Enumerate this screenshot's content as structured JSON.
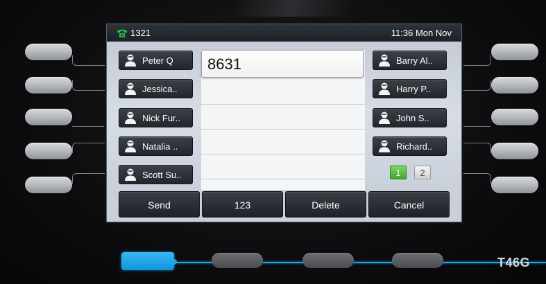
{
  "status_bar": {
    "line_number": "1321",
    "datetime": "11:36 Mon Nov",
    "phone_icon": "phone-handset-icon"
  },
  "contacts_left": [
    {
      "name": "Peter Q"
    },
    {
      "name": "Jessica.."
    },
    {
      "name": "Nick Fur.."
    },
    {
      "name": "Natalia .."
    },
    {
      "name": "Scott Su.."
    }
  ],
  "contacts_right": [
    {
      "name": "Barry Al.."
    },
    {
      "name": "Harry P.."
    },
    {
      "name": "John S.."
    },
    {
      "name": "Richard.."
    }
  ],
  "dial_entry": {
    "value": "8631"
  },
  "pages": {
    "page1": "1",
    "page2": "2",
    "current": 1
  },
  "softkeys": {
    "send": "Send",
    "mode": "123",
    "delete": "Delete",
    "cancel": "Cancel"
  },
  "device": {
    "model": "T46G"
  },
  "colors": {
    "accent": "#19a6ec",
    "page_active": "#3ea62e"
  }
}
